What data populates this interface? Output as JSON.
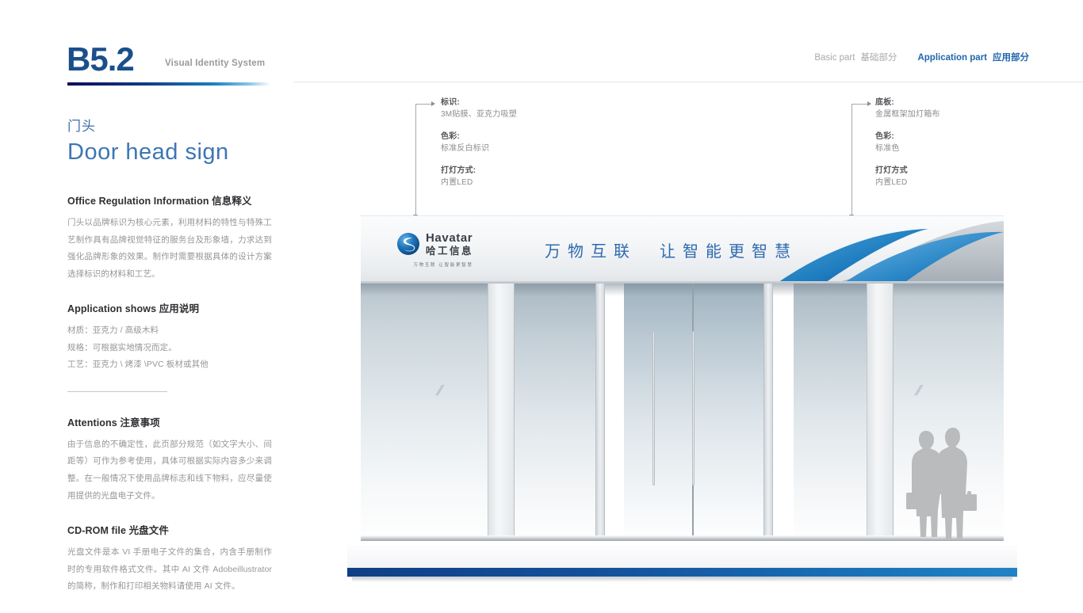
{
  "header": {
    "page_code": "B5.2",
    "system_label": "Visual Identity System",
    "nav": {
      "basic_en": "Basic part",
      "basic_cn": "基础部分",
      "app_en": "Application part",
      "app_cn": "应用部分"
    }
  },
  "left": {
    "title_cn": "门头",
    "title_en": "Door head sign",
    "sections": [
      {
        "heading": "Office Regulation Information 信息释义",
        "body": "门头以品牌标识为核心元素，利用材料的特性与特殊工艺制作具有品牌视觉特征的服务台及形象墙，力求达到强化品牌形象的效果。制作时需要根据具体的设计方案选择标识的材料和工艺。"
      },
      {
        "heading": "Application shows 应用说明",
        "line1": "材质：亚克力 / 高级木料",
        "line2": "规格：可根据实地情况而定。",
        "line3": "工艺：亚克力 \\ 烤漆 \\PVC 板材或其他"
      },
      {
        "heading": "Attentions 注意事项",
        "body": "由于信息的不确定性，此页部分规范（如文字大小、间距等）可作为参考使用，具体可根据实际内容多少来调整。在一般情况下使用品牌标志和线下物料，应尽量使用提供的光盘电子文件。"
      },
      {
        "heading": "CD-ROM file 光盘文件",
        "body": "光盘文件是本 VI 手册电子文件的集合，内含手册制作时的专用软件格式文件。其中 AI 文件 Adobeillustrator 的简称，制作和打印相关物料请使用 AI 文件。"
      }
    ]
  },
  "callouts": {
    "left": {
      "rows": [
        {
          "label": "标识:",
          "value": "3M贴膜、亚克力吸塑"
        },
        {
          "label": "色彩:",
          "value": "标准反白标识"
        },
        {
          "label": "打灯方式:",
          "value": "内置LED"
        }
      ]
    },
    "right": {
      "rows": [
        {
          "label": "底板:",
          "value": "金属框架加灯箱布"
        },
        {
          "label": "色彩:",
          "value": "标准色"
        },
        {
          "label": "打灯方式",
          "value": "内置LED"
        }
      ]
    }
  },
  "render": {
    "logo": {
      "name_en": "Havatar",
      "name_cn": "哈工信息",
      "slogan_small": "万物互联  让智能更智慧"
    },
    "signboard_slogan": "万物互联　让智能更智慧"
  },
  "colors": {
    "accent_blue": "#2266ad",
    "title_blue": "#3e76b3",
    "code_blue": "#1a4f8a",
    "band_dark": "#0f3f85",
    "band_light": "#2083c6",
    "body_gray": "#96969a",
    "rule_gray": "#e2e3e5"
  }
}
